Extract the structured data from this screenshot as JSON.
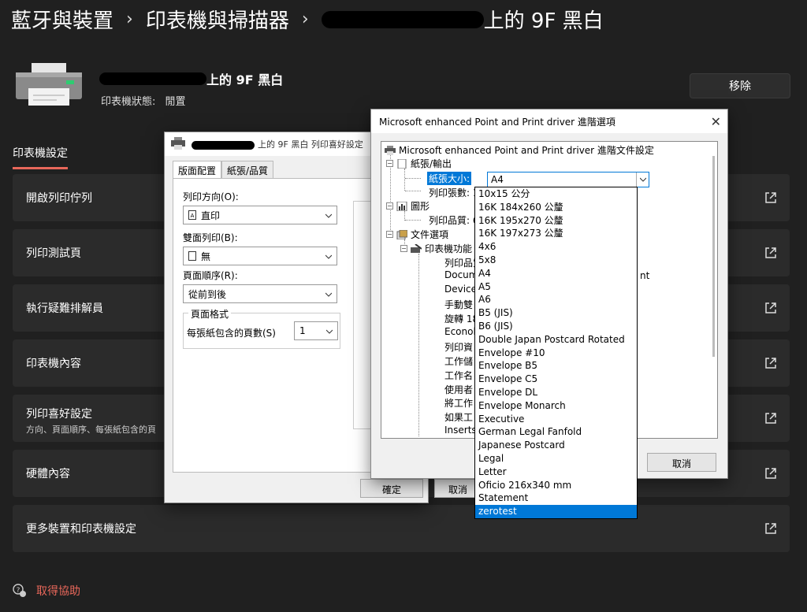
{
  "breadcrumb": {
    "items": [
      "藍牙與裝置",
      "印表機與掃描器"
    ],
    "current_suffix": "上的 9F 黑白",
    "separator": "›"
  },
  "device": {
    "title_suffix": "上的 9F 黑白",
    "status_label": "印表機狀態:",
    "status_value": "閒置",
    "remove_label": "移除"
  },
  "section_tab": "印表機設定",
  "settings_rows": [
    {
      "label": "開啟列印佇列"
    },
    {
      "label": "列印測試頁"
    },
    {
      "label": "執行疑難排解員"
    },
    {
      "label": "印表機內容"
    },
    {
      "label": "列印喜好設定",
      "sub": "方向、頁面順序、每張紙包含的頁"
    },
    {
      "label": "硬體內容"
    },
    {
      "label": "更多裝置和印表機設定"
    }
  ],
  "help_link": "取得協助",
  "pref_dialog": {
    "title": "上的 9F 黑白 列印喜好設定",
    "tabs": [
      "版面配置",
      "紙張/品質"
    ],
    "orientation_label": "列印方向(O):",
    "orientation_value": "直印",
    "duplex_label": "雙面列印(B):",
    "duplex_value": "無",
    "page_order_label": "頁面順序(R):",
    "page_order_value": "從前到後",
    "page_format_group": "頁面格式",
    "pages_per_sheet_label": "每張紙包含的頁數(S)",
    "pages_per_sheet_value": "1",
    "ok_label": "確定",
    "cancel_label": "取消"
  },
  "adv_dialog": {
    "title": "Microsoft enhanced Point and Print driver 進階選項",
    "close": "✕",
    "root": "Microsoft enhanced Point and Print driver 進階文件設定",
    "paper_output": "紙張/輸出",
    "paper_size_label": "紙張大小:",
    "paper_size_value": "A4",
    "copy_count": "列印張數: 1",
    "graphics": "圖形",
    "print_quality": "列印品質: 6",
    "doc_options": "文件選項",
    "printer_features": "印表機功能",
    "feature_items": [
      "列印品質",
      "Docum",
      "Device",
      "手動雙",
      "旋轉 18",
      "Econol",
      "列印資",
      "工作儲",
      "工作名",
      "使用者",
      "將工作",
      "如果工",
      "Inserts:"
    ],
    "doc_suffix_fragment": "nt",
    "cancel_label": "取消"
  },
  "paper_options": [
    "10x15 公分",
    "16K 184x260 公釐",
    "16K 195x270 公釐",
    "16K 197x273 公釐",
    "4x6",
    "5x8",
    "A4",
    "A5",
    "A6",
    "B5 (JIS)",
    "B6 (JIS)",
    "Double Japan Postcard Rotated",
    "Envelope #10",
    "Envelope B5",
    "Envelope C5",
    "Envelope DL",
    "Envelope Monarch",
    "Executive",
    "German Legal Fanfold",
    "Japanese Postcard",
    "Legal",
    "Letter",
    "Oficio 216x340 mm",
    "Statement",
    "zerotest"
  ],
  "paper_selected_index": 24,
  "colors": {
    "accent": "#e8675a",
    "page_bg": "#202020",
    "card_bg": "#2b2b2b",
    "selection_blue": "#0078d7"
  }
}
